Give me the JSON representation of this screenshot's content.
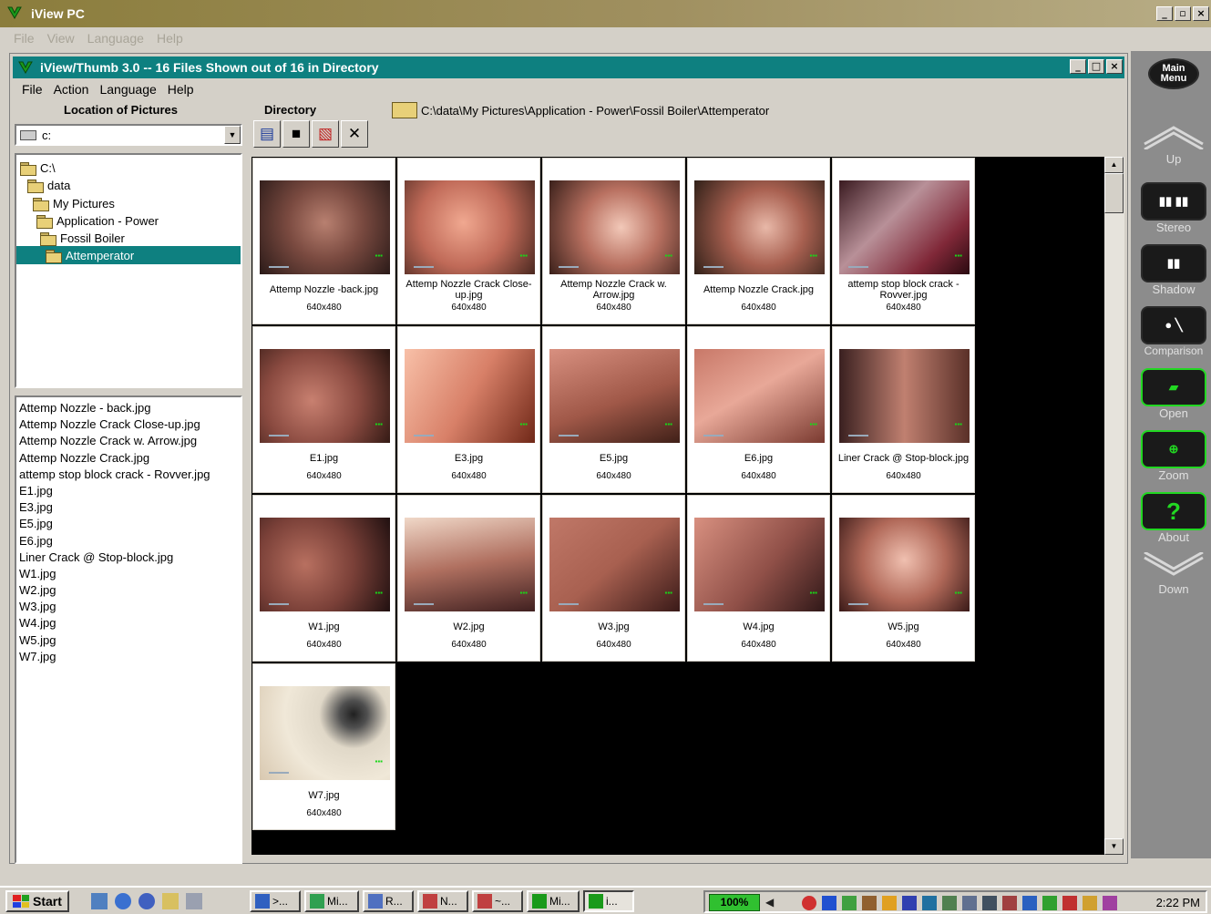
{
  "outer_window": {
    "title": "iView PC",
    "menu": [
      "File",
      "View",
      "Language",
      "Help"
    ]
  },
  "inner_window": {
    "title": "iView/Thumb 3.0 -- 16 Files Shown out of 16 in Directory",
    "menu": [
      "File",
      "Action",
      "Language",
      "Help"
    ]
  },
  "location_label": "Location of Pictures",
  "directory_label": "Directory",
  "drive_value": "c:",
  "directory_path": "C:\\data\\My Pictures\\Application - Power\\Fossil Boiler\\Attemperator",
  "tree": [
    "C:\\",
    "data",
    "My Pictures",
    "Application - Power",
    "Fossil Boiler",
    "Attemperator"
  ],
  "files": [
    "Attemp Nozzle - back.jpg",
    "Attemp Nozzle Crack Close-up.jpg",
    "Attemp Nozzle Crack w. Arrow.jpg",
    "Attemp Nozzle Crack.jpg",
    "attemp stop block crack - Rovver.jpg",
    "E1.jpg",
    "E3.jpg",
    "E5.jpg",
    "E6.jpg",
    "Liner Crack @ Stop-block.jpg",
    "W1.jpg",
    "W2.jpg",
    "W3.jpg",
    "W4.jpg",
    "W5.jpg",
    "W7.jpg"
  ],
  "thumbnails": [
    {
      "caption": "Attemp Nozzle -back.jpg",
      "res": "640x480"
    },
    {
      "caption": "Attemp Nozzle Crack Close-up.jpg",
      "res": "640x480"
    },
    {
      "caption": "Attemp Nozzle Crack w. Arrow.jpg",
      "res": "640x480"
    },
    {
      "caption": "Attemp Nozzle Crack.jpg",
      "res": "640x480"
    },
    {
      "caption": "attemp stop block crack - Rovver.jpg",
      "res": "640x480"
    },
    {
      "caption": "E1.jpg",
      "res": "640x480"
    },
    {
      "caption": "E3.jpg",
      "res": "640x480"
    },
    {
      "caption": "E5.jpg",
      "res": "640x480"
    },
    {
      "caption": "E6.jpg",
      "res": "640x480"
    },
    {
      "caption": "Liner Crack @ Stop-block.jpg",
      "res": "640x480"
    },
    {
      "caption": "W1.jpg",
      "res": "640x480"
    },
    {
      "caption": "W2.jpg",
      "res": "640x480"
    },
    {
      "caption": "W3.jpg",
      "res": "640x480"
    },
    {
      "caption": "W4.jpg",
      "res": "640x480"
    },
    {
      "caption": "W5.jpg",
      "res": "640x480"
    },
    {
      "caption": "W7.jpg",
      "res": "640x480"
    }
  ],
  "side_panel": {
    "main_menu": "Main Menu",
    "buttons": [
      "Up",
      "Stereo",
      "Shadow",
      "Comparison",
      "Open",
      "Zoom",
      "About",
      "Down"
    ]
  },
  "taskbar": {
    "start": "Start",
    "tasks": [
      ">...",
      "Mi...",
      "R...",
      "N...",
      "~...",
      "Mi...",
      "i..."
    ],
    "zoom": "100%",
    "clock": "2:22 PM"
  }
}
